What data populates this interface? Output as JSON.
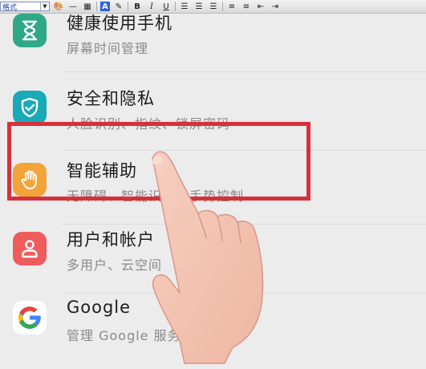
{
  "toolbar": {
    "style_value": "格式",
    "bold_label": "B",
    "italic_label": "I",
    "underline_label": "U",
    "font_color_label": "A"
  },
  "settings": [
    {
      "title": "健康使用手机",
      "subtitle": "屏幕时间管理",
      "icon": "hourglass-icon",
      "color": "#2fa887"
    },
    {
      "title": "安全和隐私",
      "subtitle": "人脸识别、指纹、锁屏密码",
      "icon": "shield-icon",
      "color": "#19a9b8"
    },
    {
      "title": "智能辅助",
      "subtitle": "无障碍、智能识屏、手势控制",
      "icon": "hand-icon",
      "color": "#f2a43a"
    },
    {
      "title": "用户和帐户",
      "subtitle": "多用户、云空间",
      "icon": "user-icon",
      "color": "#ee5c5c"
    },
    {
      "title": "Google",
      "subtitle": "管理 Google 服务",
      "icon": "google-icon",
      "color": "#ffffff"
    }
  ],
  "highlight_color": "#d7303b"
}
